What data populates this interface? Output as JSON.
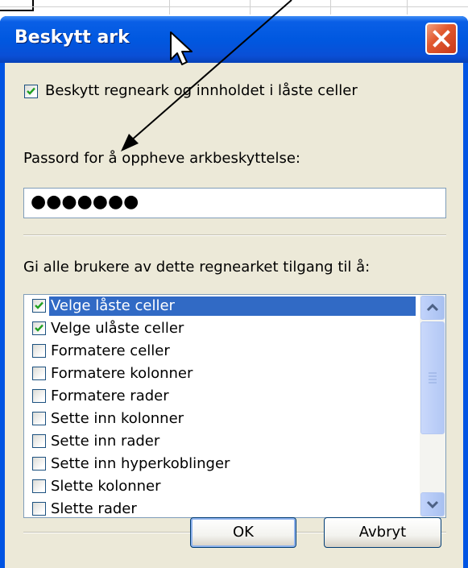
{
  "dialog": {
    "title": "Beskytt ark",
    "protect_checkbox_label": "Beskytt regneark og innholdet i låste celler",
    "protect_checked": true,
    "password_label": "Passord for å oppheve arkbeskyttelse:",
    "password_value": "●●●●●●●",
    "permissions_label": "Gi alle brukere av dette regnearket tilgang til å:",
    "permissions": [
      {
        "label": "Velge låste celler",
        "checked": true,
        "selected": true
      },
      {
        "label": "Velge ulåste celler",
        "checked": true,
        "selected": false
      },
      {
        "label": "Formatere celler",
        "checked": false,
        "selected": false
      },
      {
        "label": "Formatere kolonner",
        "checked": false,
        "selected": false
      },
      {
        "label": "Formatere rader",
        "checked": false,
        "selected": false
      },
      {
        "label": "Sette inn kolonner",
        "checked": false,
        "selected": false
      },
      {
        "label": "Sette inn rader",
        "checked": false,
        "selected": false
      },
      {
        "label": "Sette inn hyperkoblinger",
        "checked": false,
        "selected": false
      },
      {
        "label": "Slette kolonner",
        "checked": false,
        "selected": false
      },
      {
        "label": "Slette rader",
        "checked": false,
        "selected": false
      }
    ],
    "ok_label": "OK",
    "cancel_label": "Avbryt"
  },
  "colors": {
    "titlebar": "#0058e0",
    "close_button": "#e25a2f",
    "selection": "#316ac5",
    "dialog_face": "#ece9d8",
    "check_mark": "#21a121"
  },
  "icons": [
    "close-icon",
    "checkmark-icon",
    "scroll-up-icon",
    "scroll-down-icon",
    "mouse-cursor-icon",
    "annotation-arrow-icon"
  ]
}
